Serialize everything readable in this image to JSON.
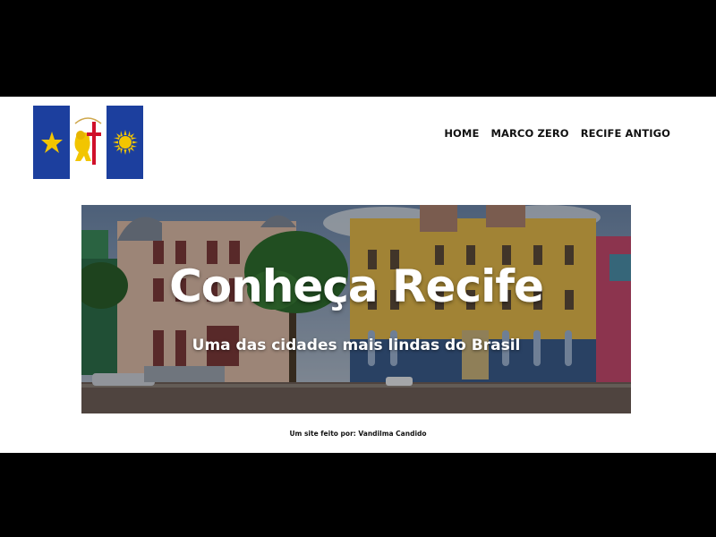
{
  "nav": {
    "items": [
      {
        "label": "HOME"
      },
      {
        "label": "MARCO ZERO"
      },
      {
        "label": "RECIFE ANTIGO"
      }
    ]
  },
  "hero": {
    "title": "Conheça Recife",
    "subtitle": "Uma das cidades mais lindas do Brasil",
    "overlay_color": "#000000"
  },
  "footer": {
    "credit": "Um site feito por: Vandilma Candido"
  },
  "colors": {
    "flag_blue": "#1c3f9e",
    "flag_yellow": "#f2c500",
    "flag_red": "#d0102a"
  }
}
